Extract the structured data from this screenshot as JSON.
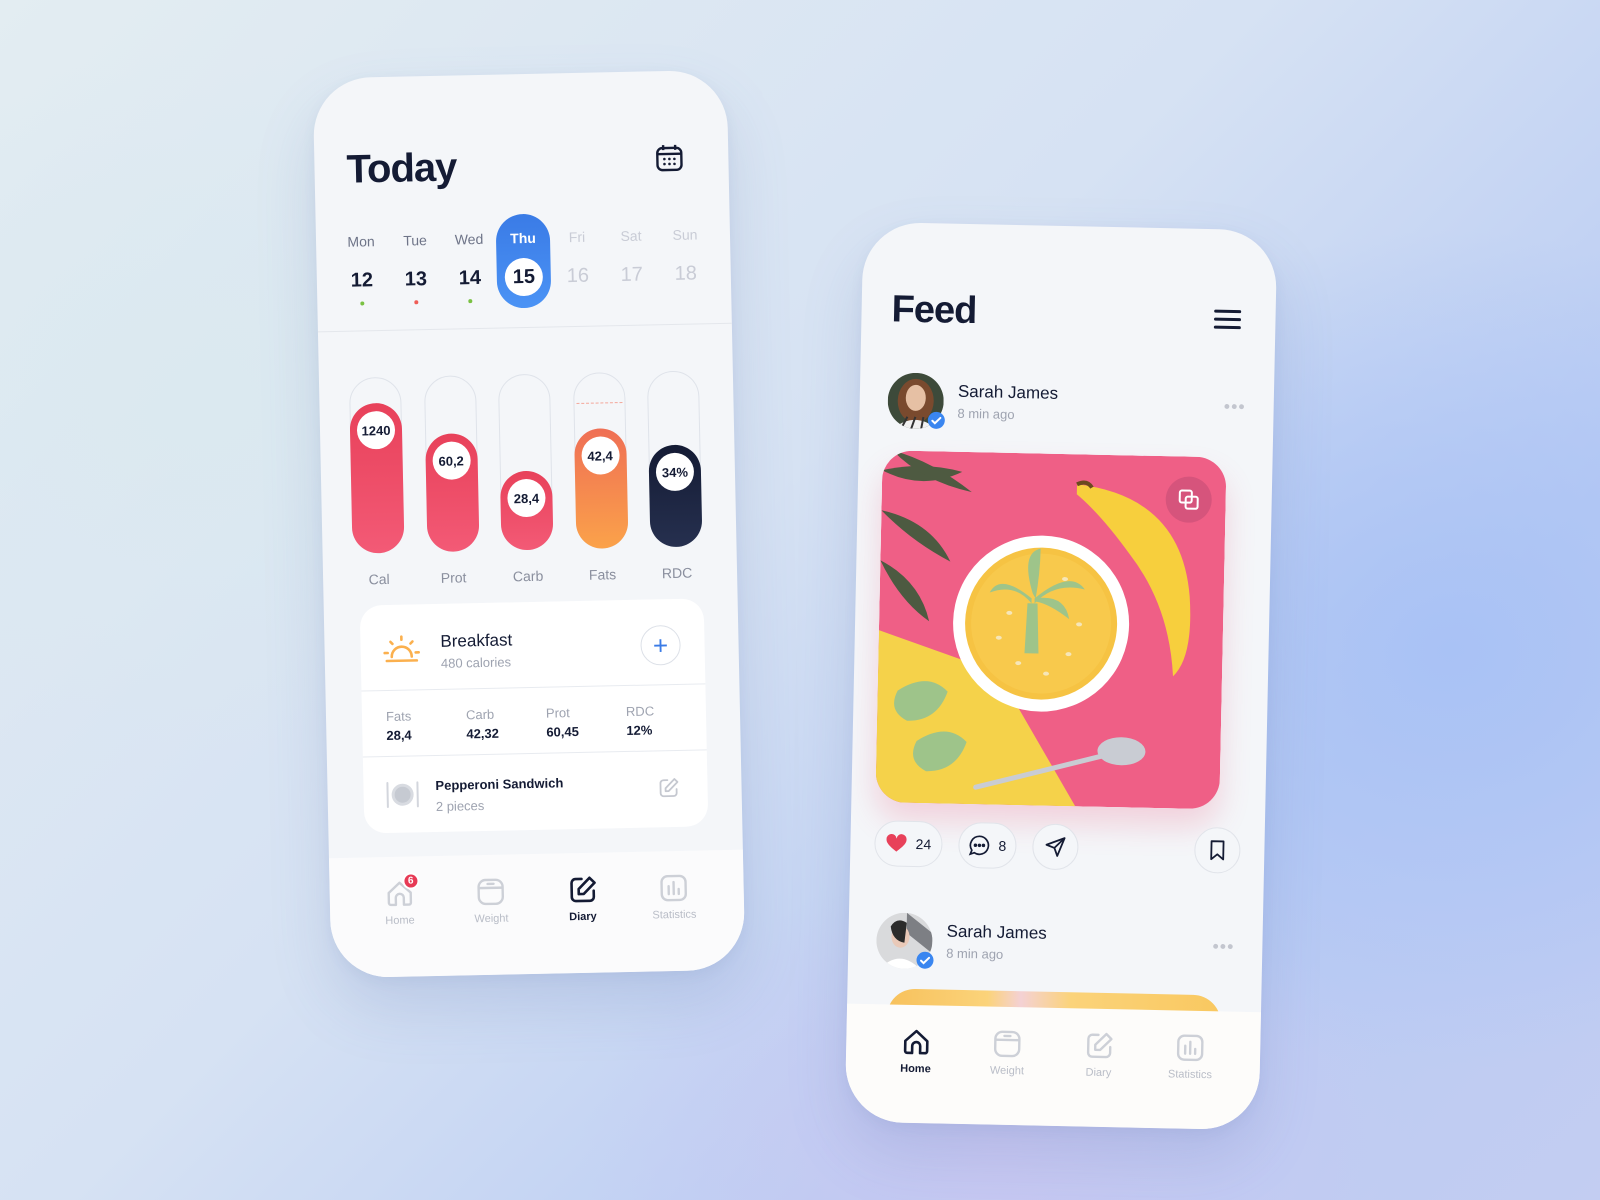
{
  "today_screen": {
    "title": "Today",
    "calendar_icon": "calendar-icon",
    "week": [
      {
        "name": "Mon",
        "num": "12",
        "dot": "#7ac143",
        "state": "past"
      },
      {
        "name": "Tue",
        "num": "13",
        "dot": "#ef5d57",
        "state": "past"
      },
      {
        "name": "Wed",
        "num": "14",
        "dot": "#7ac143",
        "state": "past"
      },
      {
        "name": "Thu",
        "num": "15",
        "dot": null,
        "state": "active"
      },
      {
        "name": "Fri",
        "num": "16",
        "dot": null,
        "state": "future"
      },
      {
        "name": "Sat",
        "num": "17",
        "dot": null,
        "state": "future"
      },
      {
        "name": "Sun",
        "num": "18",
        "dot": null,
        "state": "future"
      }
    ],
    "bars": [
      {
        "label": "Cal",
        "value": "1240",
        "fill_fraction": 0.85,
        "colors": [
          "#e8415a",
          "#f35a76"
        ]
      },
      {
        "label": "Prot",
        "value": "60,2",
        "fill_fraction": 0.67,
        "colors": [
          "#e8415a",
          "#f35a76"
        ]
      },
      {
        "label": "Carb",
        "value": "28,4",
        "fill_fraction": 0.45,
        "colors": [
          "#e8415a",
          "#f35a76"
        ]
      },
      {
        "label": "Fats",
        "value": "42,4",
        "fill_fraction": 0.68,
        "target_fraction": 0.82,
        "colors": [
          "#ef6f55",
          "#fba24a"
        ]
      },
      {
        "label": "RDC",
        "value": "34%",
        "fill_fraction": 0.58,
        "colors": [
          "#141b34",
          "#26304f"
        ]
      }
    ],
    "meal": {
      "icon": "sunrise-icon",
      "title": "Breakfast",
      "calories": "480 calories",
      "add_label": "+",
      "macros": [
        {
          "label": "Fats",
          "value": "28,4"
        },
        {
          "label": "Carb",
          "value": "42,32"
        },
        {
          "label": "Prot",
          "value": "60,45"
        },
        {
          "label": "RDC",
          "value": "12%"
        }
      ],
      "food": {
        "name": "Pepperoni Sandwich",
        "qty": "2 pieces"
      }
    },
    "nav": [
      {
        "label": "Home",
        "icon": "home-icon",
        "badge": "6",
        "active": false
      },
      {
        "label": "Weight",
        "icon": "scale-icon",
        "active": false
      },
      {
        "label": "Diary",
        "icon": "edit-icon",
        "active": true
      },
      {
        "label": "Statistics",
        "icon": "chart-icon",
        "active": false
      }
    ]
  },
  "feed_screen": {
    "title": "Feed",
    "menu_icon": "hamburger-icon",
    "posts": [
      {
        "author": "Sarah James",
        "time": "8 min ago",
        "verified": true,
        "likes": "24",
        "comments": "8"
      },
      {
        "author": "Sarah James",
        "time": "8 min ago",
        "verified": true
      }
    ],
    "more_label": "•••",
    "colors": {
      "accent": "#3a7be6",
      "like": "#e8415a",
      "post_bg": "#ef5f86",
      "post_yellow": "#f5d24a"
    },
    "nav": [
      {
        "label": "Home",
        "icon": "home-icon",
        "active": true
      },
      {
        "label": "Weight",
        "icon": "scale-icon",
        "active": false
      },
      {
        "label": "Diary",
        "icon": "edit-icon",
        "active": false
      },
      {
        "label": "Statistics",
        "icon": "chart-icon",
        "active": false
      }
    ]
  }
}
